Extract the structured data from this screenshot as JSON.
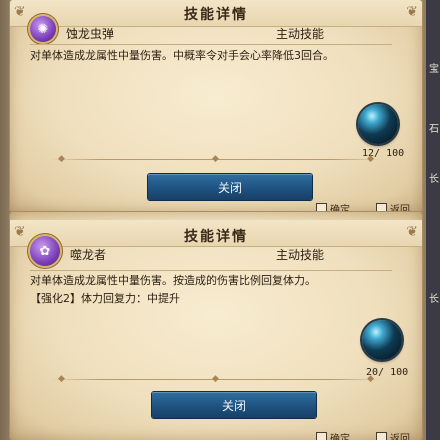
{
  "panels": [
    {
      "title": "技能详情",
      "skill": {
        "icon": "purple-bug-orb-icon",
        "name": "蚀龙虫弹",
        "type": "主动技能"
      },
      "description": [
        "对单体造成龙属性中量伤害。中概率令对手会心率降低3回合。"
      ],
      "counter": "12/ 100",
      "close_label": "关闭",
      "footer": {
        "confirm": "确定",
        "back": "返回"
      }
    },
    {
      "title": "技能详情",
      "skill": {
        "icon": "purple-flower-orb-icon",
        "name": "噬龙者",
        "type": "主动技能"
      },
      "description": [
        "对单体造成龙属性中量伤害。按造成的伤害比例回复体力。",
        "【强化2】体力回复力：中提升"
      ],
      "counter": "20/ 100",
      "close_label": "关闭",
      "footer": {
        "confirm": "确定",
        "back": "返回"
      }
    }
  ],
  "side_labels": [
    "宝",
    "石",
    "长",
    "长"
  ],
  "colors": {
    "button_blue": "#1f5280",
    "parchment": "#efdfbd",
    "icon_purple": "#7b3fb8",
    "orb_cyan": "#3fa9d0"
  }
}
